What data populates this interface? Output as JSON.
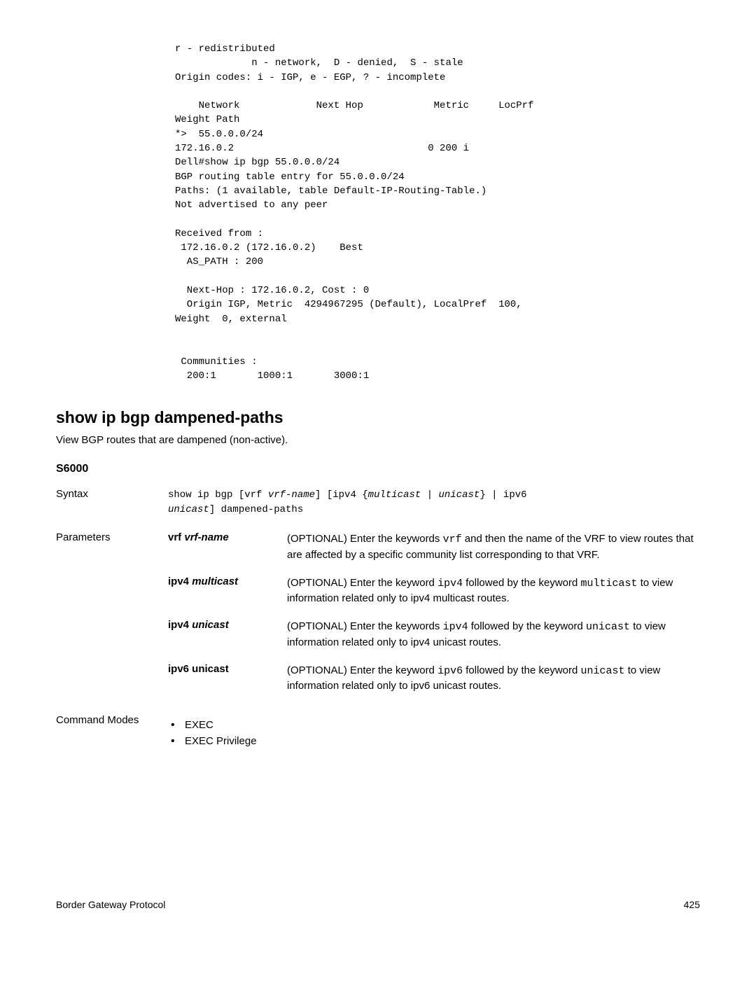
{
  "code": "r - redistributed\n             n - network,  D - denied,  S - stale\nOrigin codes: i - IGP, e - EGP, ? - incomplete\n\n    Network             Next Hop            Metric     LocPrf  \nWeight Path\n*>  55.0.0.0/24         \n172.16.0.2                                 0 200 i\nDell#show ip bgp 55.0.0.0/24\nBGP routing table entry for 55.0.0.0/24\nPaths: (1 available, table Default-IP-Routing-Table.)\nNot advertised to any peer\n\nReceived from :\n 172.16.0.2 (172.16.0.2)    Best\n  AS_PATH : 200\n\n  Next-Hop : 172.16.0.2, Cost : 0\n  Origin IGP, Metric  4294967295 (Default), LocalPref  100, \nWeight  0, external\n\n\n Communities :\n  200:1       1000:1       3000:1",
  "section": {
    "heading": "show ip bgp dampened-paths",
    "intro": "View BGP routes that are dampened (non-active).",
    "subhead": "S6000"
  },
  "syntax": {
    "label": "Syntax",
    "code": "show ip bgp [vrf vrf-name] [ipv4 {multicast | unicast} | ipv6 \nunicast] dampened-paths"
  },
  "parameters": {
    "label": "Parameters",
    "items": [
      {
        "name_html": "<span class='bold'>vrf</span> <span class='bolditalic'>vrf-name</span>",
        "desc_html": "(OPTIONAL) Enter the keywords <span class='mono'>vrf</span> and then the name of the VRF to view routes that are affected by a specific community list corresponding to that VRF."
      },
      {
        "name_html": "<span class='bold'>ipv4</span> <span class='bolditalic'>multicast</span>",
        "desc_html": "(OPTIONAL) Enter the keyword <span class='mono'>ipv4</span> followed by the keyword <span class='mono'>multicast</span> to view information related only to ipv4 multicast routes."
      },
      {
        "name_html": "<span class='bold'>ipv4</span> <span class='bolditalic'>unicast</span>",
        "desc_html": "(OPTIONAL) Enter the keywords <span class='mono'>ipv4</span> followed by the keyword <span class='mono'>unicast</span> to view information related only to ipv4 unicast routes."
      },
      {
        "name_html": "<span class='bold'>ipv6 unicast</span>",
        "desc_html": "(OPTIONAL) Enter the keyword <span class='mono'>ipv6</span> followed by the keyword <span class='mono'>unicast</span> to view information related only to ipv6 unicast routes."
      }
    ]
  },
  "command_modes": {
    "label": "Command Modes",
    "bullets": [
      "EXEC",
      "EXEC Privilege"
    ]
  },
  "footer": {
    "left": "Border Gateway Protocol",
    "right": "425"
  }
}
